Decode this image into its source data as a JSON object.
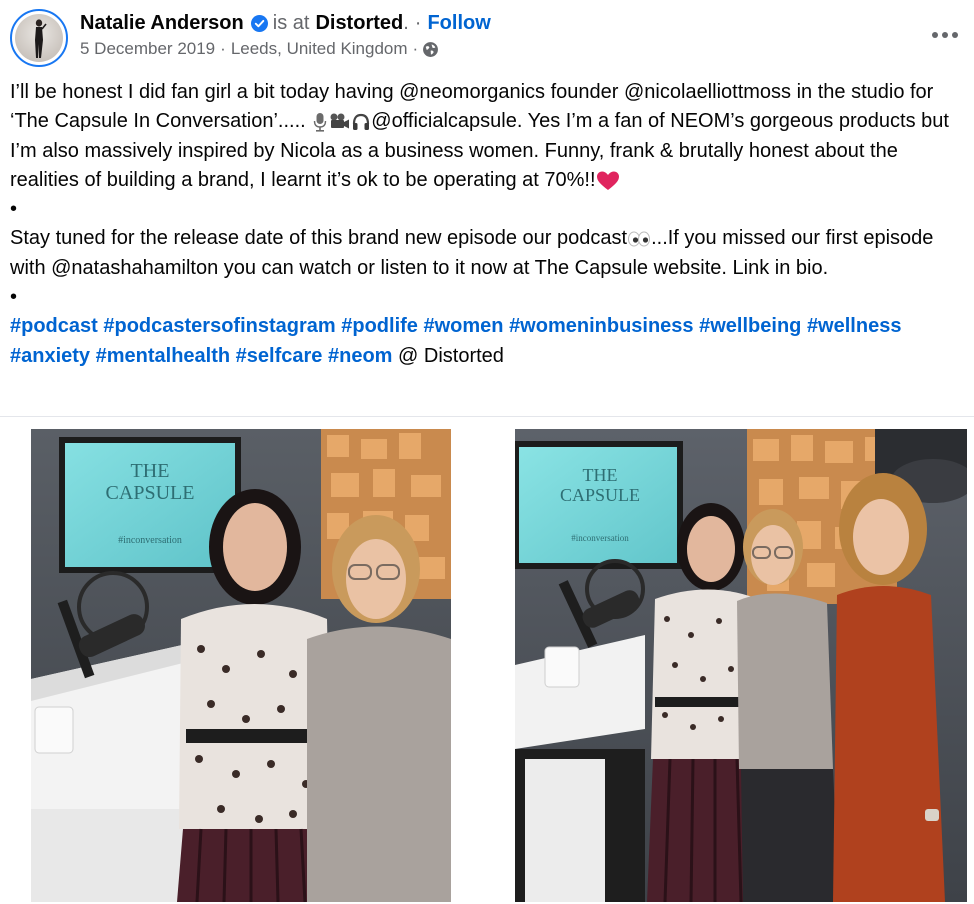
{
  "post": {
    "author": "Natalie Anderson",
    "is_at_text": "is at",
    "location_name": "Distorted",
    "follow_label": "Follow",
    "date": "5 December 2019",
    "place": "Leeds, United Kingdom",
    "dot_sep": "·",
    "text_p1": "I’ll be honest I did fan girl a bit today having @neomorganics founder @nicolaelliottmoss in the studio for ‘The Capsule In Conversation’..... ",
    "text_p1b": "@officialcapsule. Yes I’m a fan of NEOM’s gorgeous products but I’m also massively inspired by Nicola as a business women. Funny, frank & brutally honest about the realities of building a brand, I learnt it’s ok to be operating at 70%!!",
    "bullet": "•",
    "text_p2": "Stay tuned for the release date of this brand new episode our podcast",
    "text_p2b": "...If you missed our first episode with @natashahamilton you can watch or listen to it now at The Capsule website. Link in bio.",
    "hashtags": [
      "#podcast",
      "#podcastersofinstagram",
      "#podlife",
      "#women",
      "#womeninbusiness",
      "#wellbeing",
      "#wellness",
      "#anxiety",
      "#mentalhealth",
      "#selfcare",
      "#neom"
    ],
    "tail_text": "@ Distorted"
  },
  "photos": {
    "screen_title_line1": "THE",
    "screen_title_line2": "CAPSULE",
    "screen_sub": "#inconversation"
  },
  "icons": [
    "verified-badge-icon",
    "globe-icon",
    "more-options-icon",
    "microphone-emoji-icon",
    "movie-camera-emoji-icon",
    "headphones-emoji-icon",
    "heart-emoji-icon",
    "eyes-emoji-icon"
  ],
  "colors": {
    "link": "#0064d1",
    "secondary_text": "#65676b",
    "verified": "#1877f2",
    "heart": "#e0245e"
  }
}
